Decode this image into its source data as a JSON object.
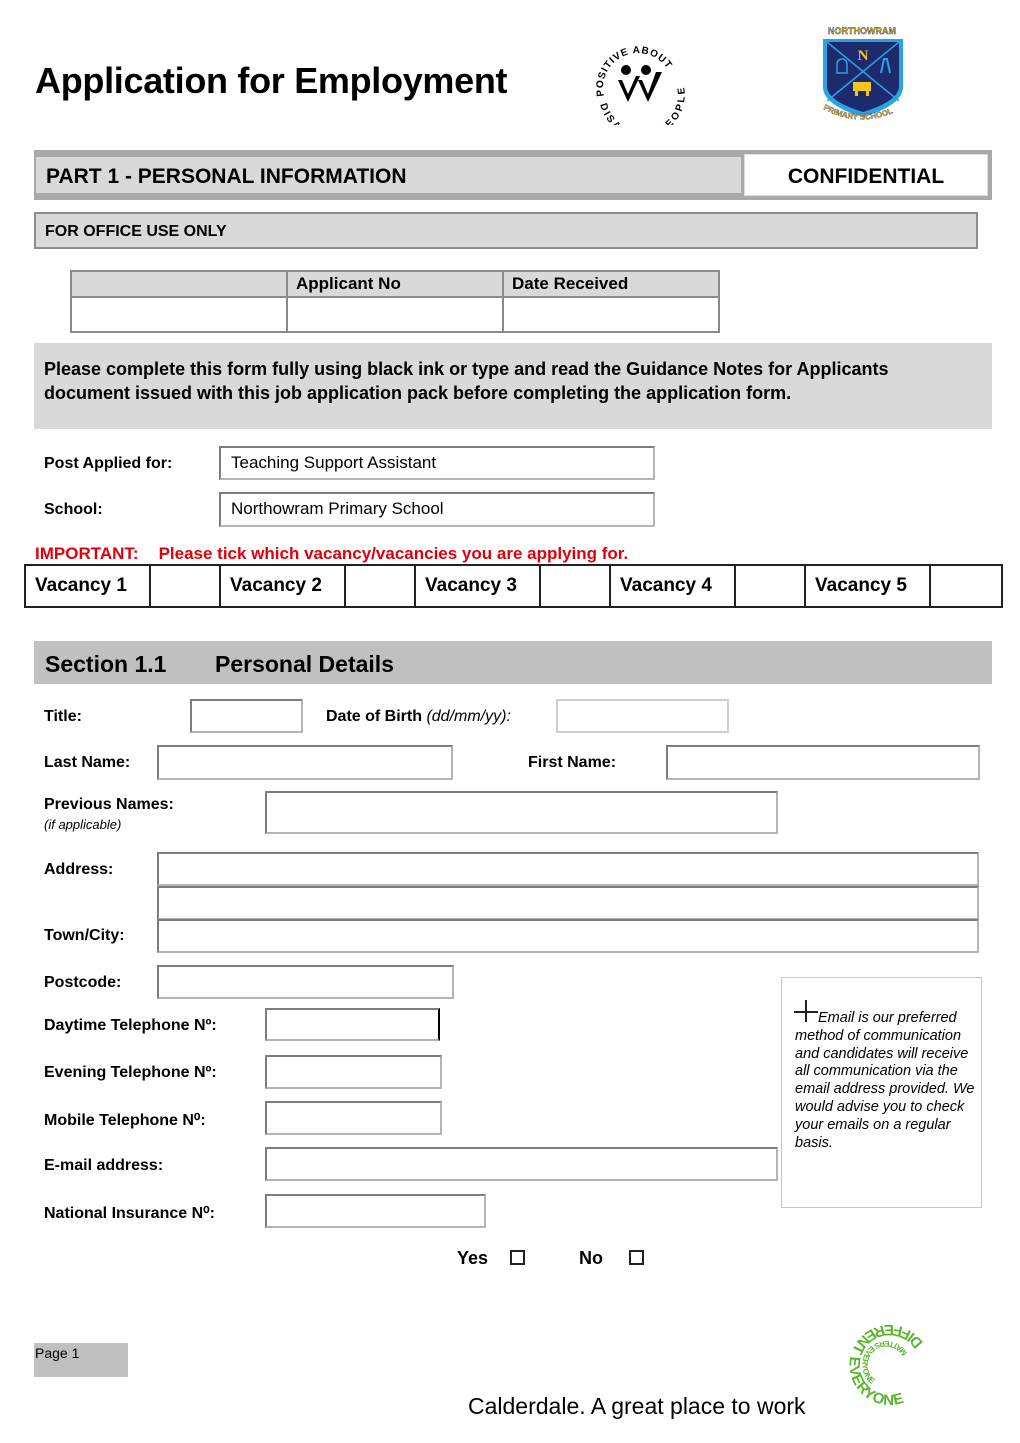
{
  "header": {
    "title": "Application for Employment",
    "logos": {
      "disability": {
        "top_text": "POSITIVE ABOUT",
        "bottom_text": "DISABLED PEOPLE",
        "icon": "two-ticks-icon"
      },
      "school": {
        "top_text": "NORTHOWRAM",
        "letter": "N",
        "bottom_text": "PRIMARY SCHOOL",
        "colors": {
          "navy": "#1e2a6e",
          "sky": "#2aa3e0",
          "gold": "#f4c51c"
        }
      }
    }
  },
  "part": {
    "title": "PART 1 - PERSONAL INFORMATION",
    "confidential": "CONFIDENTIAL"
  },
  "office": {
    "label": "FOR OFFICE USE ONLY",
    "table": {
      "headers": [
        "",
        "Applicant No",
        "Date Received"
      ],
      "row": [
        "",
        "",
        ""
      ]
    }
  },
  "notice": "Please complete this form fully using black ink or type and read the Guidance Notes for Applicants document issued with this job application pack before completing the application form.",
  "post": {
    "label": "Post Applied for:",
    "value": "Teaching Support Assistant"
  },
  "school": {
    "label": "School:",
    "value": "Northowram Primary School"
  },
  "important": {
    "prefix": "IMPORTANT:",
    "text": "Please tick which vacancy/vacancies you are applying for.",
    "color": "#e0000b"
  },
  "vacancies": [
    {
      "label": "Vacancy 1",
      "checked": false
    },
    {
      "label": "Vacancy 2",
      "checked": false
    },
    {
      "label": "Vacancy 3",
      "checked": false
    },
    {
      "label": "Vacancy 4",
      "checked": false
    },
    {
      "label": "Vacancy 5",
      "checked": false
    }
  ],
  "section": {
    "number": "Section 1.1",
    "title": "Personal Details"
  },
  "fields": {
    "title": {
      "label": "Title:",
      "value": ""
    },
    "dob": {
      "label": "Date of Birth",
      "hint": "(dd/mm/yy):",
      "value": ""
    },
    "last_name": {
      "label": "Last Name:",
      "value": ""
    },
    "first_name": {
      "label": "First Name:",
      "value": ""
    },
    "previous_names": {
      "label": "Previous Names:",
      "hint": "(if applicable)",
      "value": ""
    },
    "address": {
      "label": "Address:",
      "line1": "",
      "line2": ""
    },
    "town": {
      "label": "Town/City:",
      "value": ""
    },
    "postcode": {
      "label": "Postcode:",
      "value": ""
    },
    "day_phone": {
      "label": "Daytime Telephone Nº:",
      "value": ""
    },
    "eve_phone": {
      "label": "Evening Telephone Nº:",
      "value": ""
    },
    "mobile": {
      "label": "Mobile Telephone N⁰:",
      "value": ""
    },
    "email": {
      "label": "E-mail address:",
      "value": ""
    },
    "ni": {
      "label": "National Insurance N⁰:",
      "value": ""
    }
  },
  "email_note": "Email is our preferred method of communication and candidates will receive all communication via the email address provided.  We would advise you to check your emails on a regular basis.",
  "yes_no": {
    "yes": "Yes",
    "no": "No"
  },
  "footer": {
    "page": "Page 1",
    "tagline": "Calderdale.   A great place to work",
    "logo": {
      "outer": "EVERYONE DIFFERENT",
      "inner": "EVERYONE MATTERS",
      "color": "#5ab52e"
    }
  }
}
